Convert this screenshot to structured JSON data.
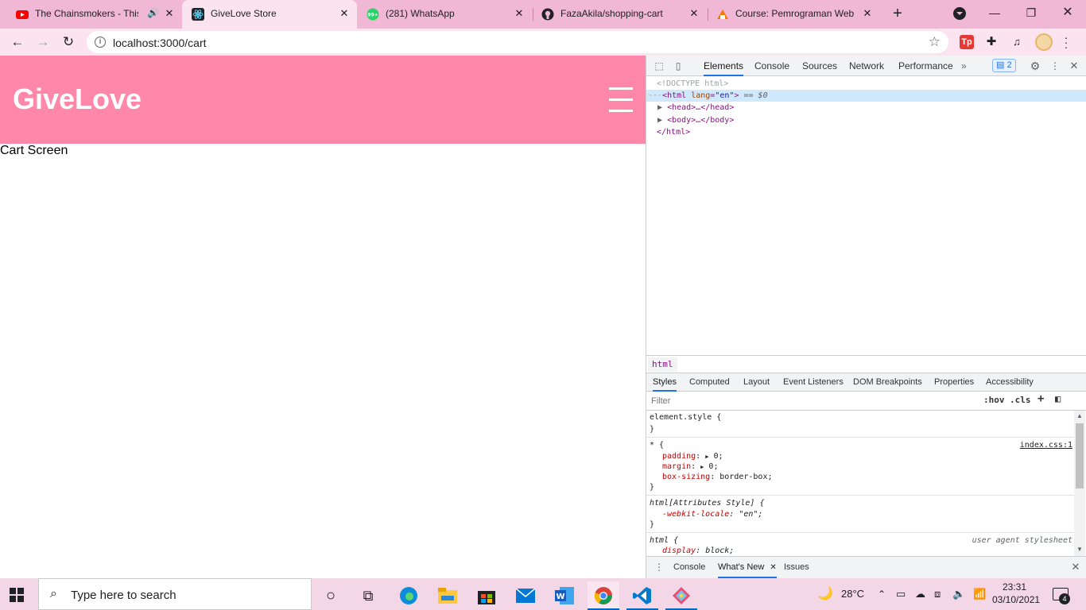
{
  "browser": {
    "tabs": [
      {
        "title": "The Chainsmokers - This",
        "favicon": "youtube-icon",
        "audio": true
      },
      {
        "title": "GiveLove Store",
        "favicon": "react-icon",
        "active": true
      },
      {
        "title": "(281) WhatsApp",
        "favicon": "whatsapp-icon"
      },
      {
        "title": "FazaAkila/shopping-cart",
        "favicon": "github-icon"
      },
      {
        "title": "Course: Pemrograman Web d",
        "favicon": "course-icon"
      }
    ],
    "url": "localhost:3000/cart",
    "accent": "#f1b8d6"
  },
  "page": {
    "brand": "GiveLove",
    "content": "Cart Screen",
    "header_color": "#ff88aa"
  },
  "devtools": {
    "tabs": [
      "Elements",
      "Console",
      "Sources",
      "Network",
      "Performance"
    ],
    "issues_badge": "2",
    "dom": {
      "doctype": "<!DOCTYPE html>",
      "html_open_tag": "<html",
      "html_attr": "lang",
      "html_attr_value": "\"en\"",
      "html_selected_marker": "== $0",
      "head": "<head>…</head>",
      "body": "<body>…</body>",
      "html_close": "</html>"
    },
    "breadcrumb": "html",
    "sub_tabs": [
      "Styles",
      "Computed",
      "Layout",
      "Event Listeners",
      "DOM Breakpoints",
      "Properties",
      "Accessibility"
    ],
    "filter_placeholder": "Filter",
    "filter_hov": ":hov",
    "filter_cls": ".cls",
    "styles": {
      "element_style": "element.style {",
      "close_brace": "}",
      "universal_selector": "* {",
      "universal_source": "index.css:1",
      "padding_prop": "padding",
      "padding_val": "0;",
      "margin_prop": "margin",
      "margin_val": "0;",
      "boxsizing_prop": "box-sizing",
      "boxsizing_val": "border-box;",
      "attr_selector": "html[Attributes Style] {",
      "locale_prop": "-webkit-locale",
      "locale_val": "\"en\";",
      "html_selector": "html {",
      "ua_source": "user agent stylesheet",
      "display_prop": "display",
      "display_val": "block;"
    },
    "drawer_tabs": [
      "Console",
      "What's New",
      "Issues"
    ]
  },
  "taskbar": {
    "search_placeholder": "Type here to search",
    "weather": "28°C",
    "time": "23:31",
    "date": "03/10/2021",
    "notifications": "4"
  }
}
